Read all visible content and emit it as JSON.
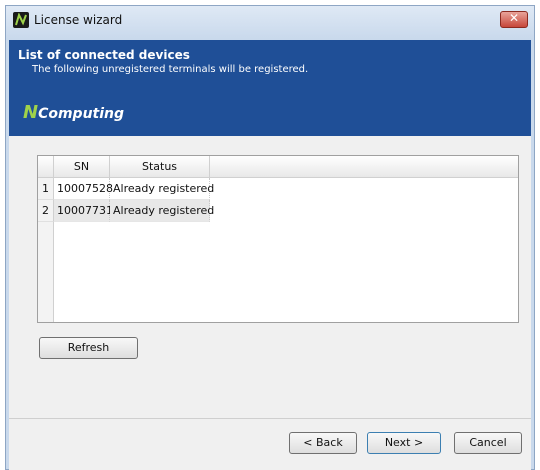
{
  "window": {
    "title": "License wizard"
  },
  "banner": {
    "title": "List of connected devices",
    "subtitle": "The following unregistered terminals will be registered.",
    "logo_mark": "N",
    "logo_text": "Computing"
  },
  "grid": {
    "columns": [
      "SN",
      "Status"
    ],
    "rows": [
      {
        "num": "1",
        "sn": "10007528",
        "status": "Already registered"
      },
      {
        "num": "2",
        "sn": "10007731",
        "status": "Already registered"
      }
    ]
  },
  "buttons": {
    "refresh": "Refresh",
    "back": "< Back",
    "next": "Next >",
    "cancel": "Cancel"
  },
  "colors": {
    "banner": "#1f4f97",
    "logo_accent": "#9fd24a"
  }
}
